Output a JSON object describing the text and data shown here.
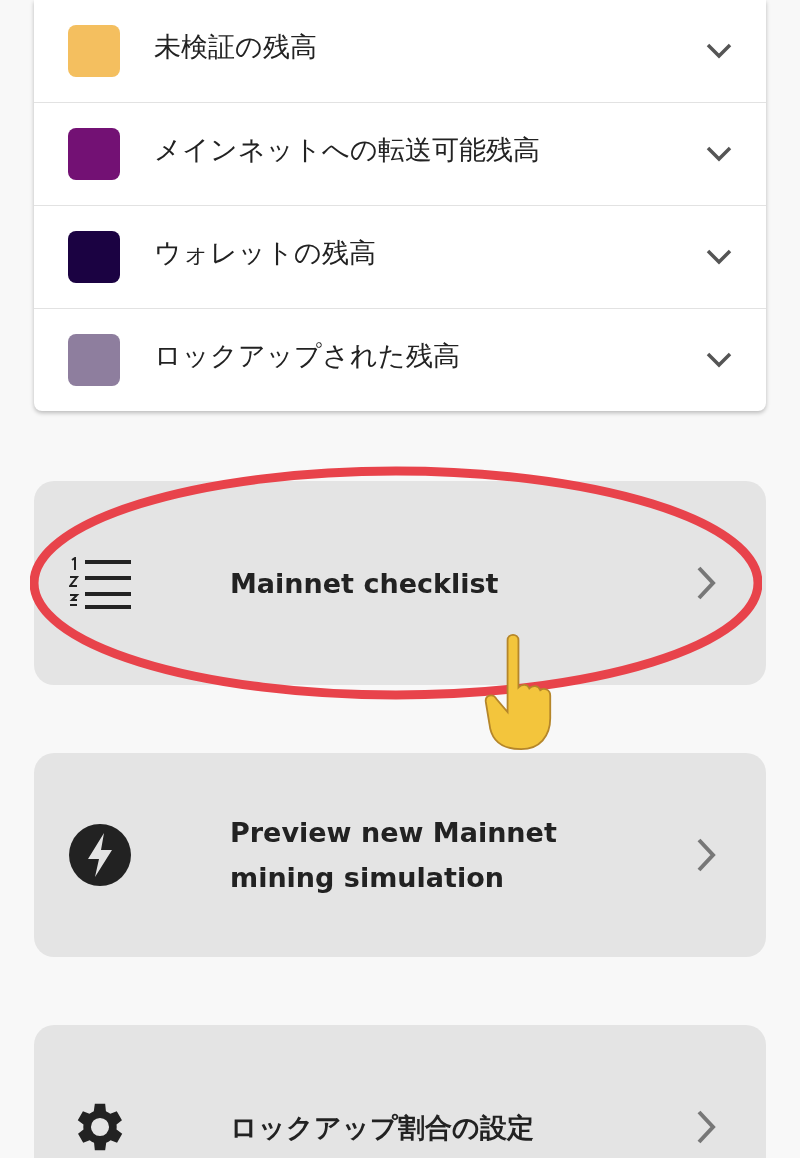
{
  "legend": [
    {
      "label": "未検証の残高",
      "color": "#f4bf5f",
      "expanded": false
    },
    {
      "label": "メインネットへの転送可能残高",
      "color": "#731174",
      "expanded": false
    },
    {
      "label": "ウォレットの残高",
      "color": "#1b0242",
      "expanded": false
    },
    {
      "label": "ロックアップされた残高",
      "color": "#8e7e9e",
      "expanded": false
    }
  ],
  "actions": [
    {
      "kind": "checklist",
      "label": "Mainnet checklist",
      "highlighted": true
    },
    {
      "kind": "bolt",
      "label": "Preview new Mainnet mining simulation",
      "highlighted": false
    },
    {
      "kind": "gear",
      "label": "ロックアップ割合の設定",
      "highlighted": false
    }
  ]
}
